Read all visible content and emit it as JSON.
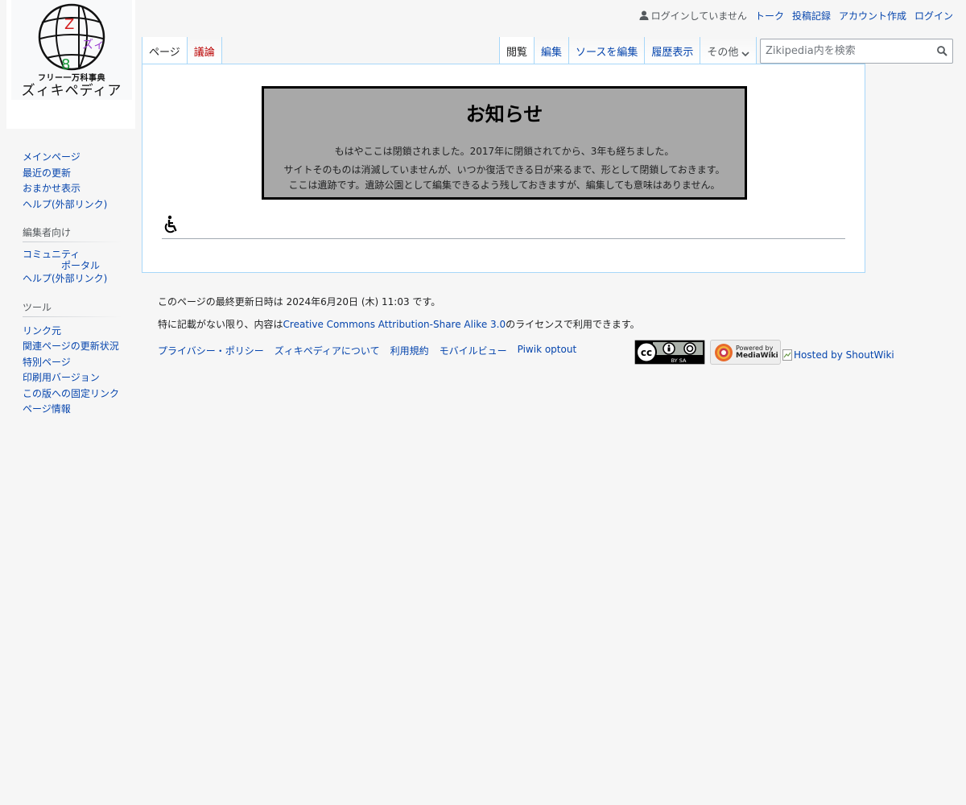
{
  "logo": {
    "caption_small": "フリー一万科事典",
    "caption_large": "ズィキペディア",
    "glyph_top": "Z",
    "glyph_mid": "ズィ",
    "glyph_bottom": "8"
  },
  "personal": {
    "status": "ログインしていません",
    "talk": "トーク",
    "contributions": "投稿記録",
    "create_account": "アカウント作成",
    "login": "ログイン"
  },
  "tabs": {
    "page": "ページ",
    "discussion": "議論",
    "read": "閲覧",
    "edit": "編集",
    "edit_source": "ソースを編集",
    "history": "履歴表示",
    "more": "その他"
  },
  "search": {
    "placeholder": "Zikipedia内を検索"
  },
  "notice": {
    "title": "お知らせ",
    "line1": "もはやここは閉鎖されました。2017年に閉鎖されてから、3年も経ちました。",
    "line2": "サイトそのものは消滅していませんが、いつか復活できる日が来るまで、形として閉鎖しておきます。",
    "line3": "ここは遺跡です。遺跡公園として編集できるよう残しておきますが、編集しても意味はありません。"
  },
  "sidebar": {
    "navigation": [
      {
        "label": "メインページ"
      },
      {
        "label": "最近の更新"
      },
      {
        "label": "おまかせ表示"
      },
      {
        "label": "ヘルプ(外部リンク)"
      }
    ],
    "editors_heading": "編集者向け",
    "editors": {
      "community_line1": "コミュニティ",
      "community_line2": "ポータル",
      "help": "ヘルプ(外部リンク)"
    },
    "tools_heading": "ツール",
    "tools": [
      {
        "label": "リンク元"
      },
      {
        "label": "関連ページの更新状況"
      },
      {
        "label": "特別ページ"
      },
      {
        "label": "印刷用バージョン"
      },
      {
        "label": "この版への固定リンク"
      },
      {
        "label": "ページ情報"
      }
    ]
  },
  "footer": {
    "last_modified": "このページの最終更新日時は 2024年6月20日 (木) 11:03 です。",
    "license_prefix": "特に記載がない限り、内容は",
    "license_link": "Creative Commons Attribution-Share Alike 3.0",
    "license_suffix": "のライセンスで利用できます。",
    "links": [
      {
        "label": "プライバシー・ポリシー"
      },
      {
        "label": "ズィキペディアについて"
      },
      {
        "label": "利用規約"
      },
      {
        "label": "モバイルビュー"
      },
      {
        "label": "Piwik optout"
      }
    ],
    "cc_badge": "BY SA",
    "mw_powered": "Powered by",
    "mw_name": "MediaWiki",
    "hosted": "Hosted by ShoutWiki"
  },
  "colors": {
    "link": "#0645ad",
    "new_link": "#ba0000",
    "tab_border": "#a7d7f9",
    "notice_bg": "#a8a8a8",
    "page_bg": "#f6f6f6"
  }
}
